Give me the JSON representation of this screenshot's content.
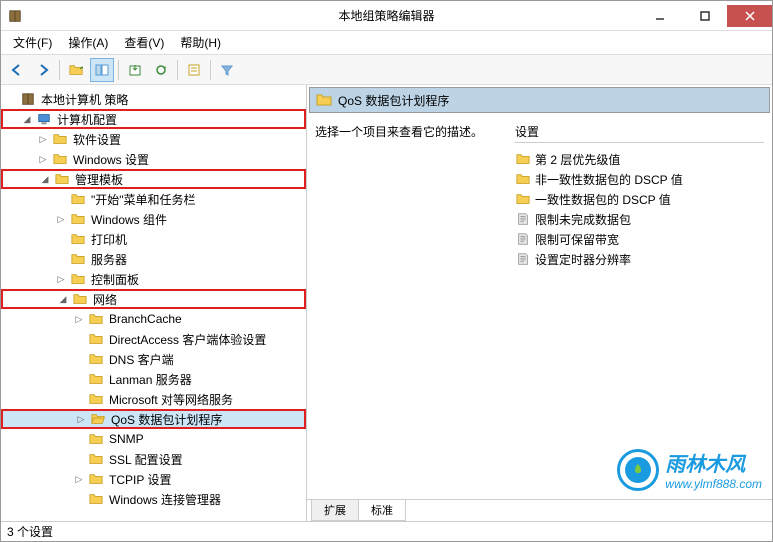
{
  "window": {
    "title": "本地组策略编辑器"
  },
  "menubar": {
    "file": "文件(F)",
    "action": "操作(A)",
    "view": "查看(V)",
    "help": "帮助(H)"
  },
  "tree": {
    "root": "本地计算机 策略",
    "computer_config": "计算机配置",
    "software_settings": "软件设置",
    "windows_settings": "Windows 设置",
    "admin_templates": "管理模板",
    "start_menu": "\"开始\"菜单和任务栏",
    "windows_components": "Windows 组件",
    "printers": "打印机",
    "servers": "服务器",
    "control_panel": "控制面板",
    "network": "网络",
    "branchcache": "BranchCache",
    "directaccess": "DirectAccess 客户端体验设置",
    "dns_client": "DNS 客户端",
    "lanman_server": "Lanman 服务器",
    "ms_p2p": "Microsoft 对等网络服务",
    "qos": "QoS 数据包计划程序",
    "snmp": "SNMP",
    "ssl_config": "SSL 配置设置",
    "tcpip": "TCPIP 设置",
    "windows_conn_mgr": "Windows 连接管理器"
  },
  "detail": {
    "header": "QoS 数据包计划程序",
    "instruction": "选择一个项目来查看它的描述。",
    "settings_label": "设置",
    "items": {
      "layer2_priority": "第 2 层优先级值",
      "nonconforming_dscp": "非一致性数据包的 DSCP 值",
      "conforming_dscp": "一致性数据包的 DSCP 值",
      "limit_outstanding": "限制未完成数据包",
      "limit_reservable": "限制可保留带宽",
      "timer_resolution": "设置定时器分辨率"
    }
  },
  "tabs": {
    "extended": "扩展",
    "standard": "标准"
  },
  "statusbar": {
    "text": "3 个设置"
  },
  "watermark": {
    "brand": "雨林木风",
    "url": "www.ylmf888.com"
  }
}
